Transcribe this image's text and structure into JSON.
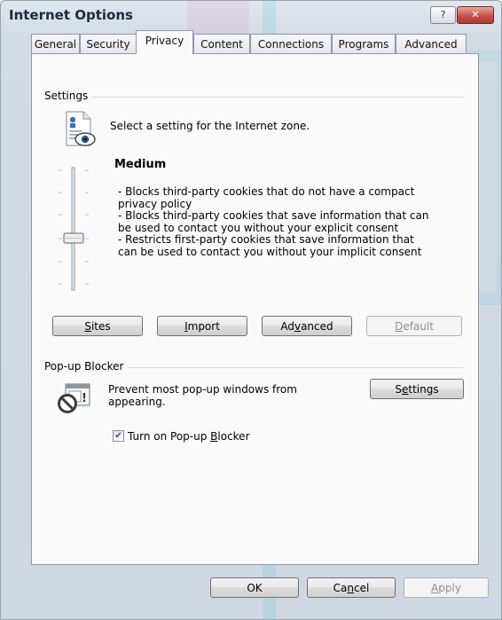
{
  "window": {
    "title": "Internet Options",
    "help_glyph": "?",
    "close_glyph": "✕"
  },
  "tabs": [
    {
      "label": "General",
      "active": false
    },
    {
      "label": "Security",
      "active": false
    },
    {
      "label": "Privacy",
      "active": true
    },
    {
      "label": "Content",
      "active": false
    },
    {
      "label": "Connections",
      "active": false
    },
    {
      "label": "Programs",
      "active": false
    },
    {
      "label": "Advanced",
      "active": false
    }
  ],
  "settings": {
    "group_label": "Settings",
    "instruction": "Select a setting for the Internet zone.",
    "level_name": "Medium",
    "description": [
      "- Blocks third-party cookies that do not have a compact",
      "privacy policy",
      "- Blocks third-party cookies that save information that can",
      "be used to contact you without your explicit consent",
      "- Restricts first-party cookies that save information that",
      "can be used to contact you without your implicit consent"
    ],
    "buttons": {
      "sites": {
        "pre": "",
        "key": "S",
        "post": "ites"
      },
      "import": {
        "pre": "",
        "key": "I",
        "post": "mport"
      },
      "advanced": {
        "pre": "Ad",
        "key": "v",
        "post": "anced"
      },
      "default": {
        "pre": "",
        "key": "D",
        "post": "efault"
      }
    }
  },
  "popup_blocker": {
    "group_label": "Pop-up Blocker",
    "text_line1": "Prevent most pop-up windows from",
    "text_line2": "appearing.",
    "settings_button": {
      "pre": "S",
      "key": "e",
      "post": "ttings"
    },
    "checkbox": {
      "checked": true,
      "pre": "Turn on Pop-up ",
      "key": "B",
      "post": "locker"
    }
  },
  "footer": {
    "ok": "OK",
    "cancel": {
      "pre": "Ca",
      "key": "n",
      "post": "cel"
    },
    "apply": {
      "pre": "",
      "key": "A",
      "post": "pply"
    }
  }
}
